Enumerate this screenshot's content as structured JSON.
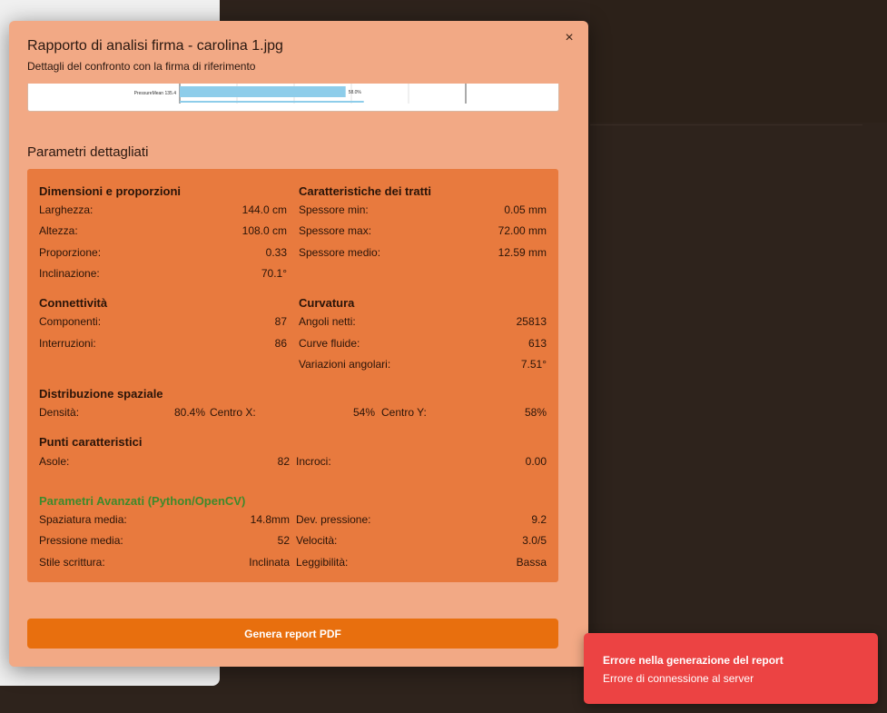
{
  "modal": {
    "title": "Rapporto di analisi firma - carolina 1.jpg",
    "subtitle": "Dettagli del confronto con la firma di riferimento",
    "close_label": "×"
  },
  "chart_data": {
    "type": "bar",
    "categories": [
      "PressureMean 135.4"
    ],
    "values": [
      58.0
    ],
    "value_labels": [
      "58.0%"
    ],
    "xlim": [
      0,
      100
    ],
    "bar_color": "#8ecdea"
  },
  "details": {
    "section_title": "Parametri dettagliati",
    "dimensions": {
      "title": "Dimensioni e proporzioni",
      "rows": [
        {
          "label": "Larghezza:",
          "value": "144.0 cm"
        },
        {
          "label": "Altezza:",
          "value": "108.0 cm"
        },
        {
          "label": "Proporzione:",
          "value": "0.33"
        },
        {
          "label": "Inclinazione:",
          "value": "70.1°"
        }
      ]
    },
    "strokes": {
      "title": "Caratteristiche dei tratti",
      "rows": [
        {
          "label": "Spessore min:",
          "value": "0.05 mm"
        },
        {
          "label": "Spessore max:",
          "value": "72.00 mm"
        },
        {
          "label": "Spessore medio:",
          "value": "12.59 mm"
        }
      ]
    },
    "connectivity": {
      "title": "Connettività",
      "rows": [
        {
          "label": "Componenti:",
          "value": "87"
        },
        {
          "label": "Interruzioni:",
          "value": "86"
        }
      ]
    },
    "curvature": {
      "title": "Curvatura",
      "rows": [
        {
          "label": "Angoli netti:",
          "value": "25813"
        },
        {
          "label": "Curve fluide:",
          "value": "613"
        },
        {
          "label": "Variazioni angolari:",
          "value": "7.51°"
        }
      ]
    },
    "spatial": {
      "title": "Distribuzione spaziale",
      "density_label": "Densità:",
      "density_value": "80.4%",
      "cx_label": "Centro X:",
      "cx_value": "54%",
      "cy_label": "Centro Y:",
      "cy_value": "58%"
    },
    "points": {
      "title": "Punti caratteristici",
      "loops_label": "Asole:",
      "loops_value": "82",
      "cross_label": "Incroci:",
      "cross_value": "0.00"
    },
    "advanced": {
      "title": "Parametri Avanzati (Python/OpenCV)",
      "title_color": "#3d8a2c",
      "rows": [
        {
          "l1": "Spaziatura media:",
          "v1": "14.8mm",
          "l2": "Dev. pressione:",
          "v2": "9.2"
        },
        {
          "l1": "Pressione media:",
          "v1": "52",
          "l2": "Velocità:",
          "v2": "3.0/5"
        },
        {
          "l1": "Stile scrittura:",
          "v1": "Inclinata",
          "l2": "Leggibilità:",
          "v2": "Bassa"
        }
      ]
    }
  },
  "actions": {
    "pdf_button": "Genera report PDF"
  },
  "toast": {
    "title": "Errore nella generazione del report",
    "message": "Errore di connessione al server",
    "color": "#ec4343"
  }
}
